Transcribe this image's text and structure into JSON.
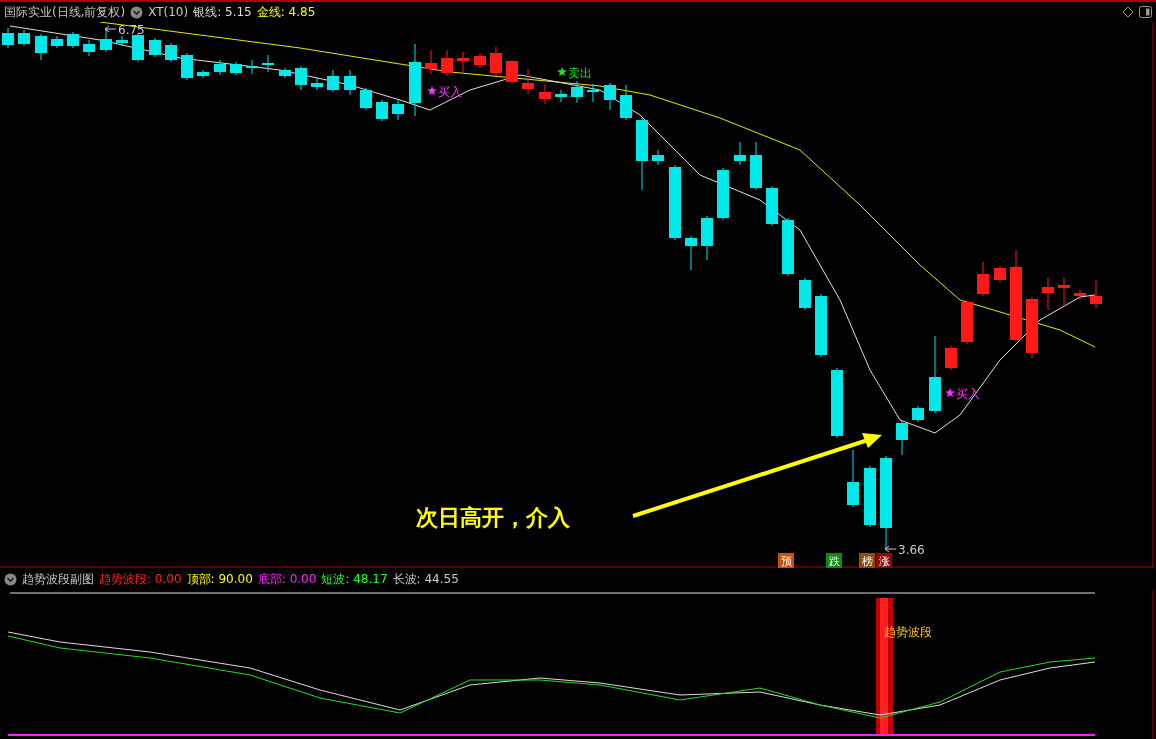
{
  "header": {
    "title": "国际实业(日线,前复权)",
    "indicator": "XT(10)",
    "lines": [
      {
        "label": "银线:",
        "value": "5.15",
        "color": "#dddddd"
      },
      {
        "label": "金线:",
        "value": "4.85",
        "color": "#ffff00"
      }
    ]
  },
  "main_chart": {
    "high_price": "6.75",
    "low_price": "3.66",
    "signals": [
      {
        "kind": "buy",
        "text": "买入"
      },
      {
        "kind": "sell",
        "text": "卖出"
      },
      {
        "kind": "buy",
        "text": "买入"
      }
    ],
    "annotation": "次日高开，介入",
    "markers": [
      {
        "text": "预",
        "color": "#c8500c"
      },
      {
        "text": "跌",
        "color": "#0c8c0c"
      },
      {
        "text": "榜",
        "color": "#8c4c10"
      },
      {
        "text": "涨",
        "color": "#8c0c0c"
      }
    ]
  },
  "sub_header": {
    "title": "趋势波段副图",
    "values": [
      {
        "label": "趋势波段:",
        "value": "0.00",
        "color": "#ff2020"
      },
      {
        "label": "顶部:",
        "value": "90.00",
        "color": "#ffff00"
      },
      {
        "label": "底部:",
        "value": "0.00",
        "color": "#ff20ff"
      },
      {
        "label": "短波:",
        "value": "48.17",
        "color": "#20ff20"
      },
      {
        "label": "长波:",
        "value": "44.55",
        "color": "#cccccc"
      }
    ]
  },
  "sub_chart": {
    "bar_label": "趋势波段"
  }
}
